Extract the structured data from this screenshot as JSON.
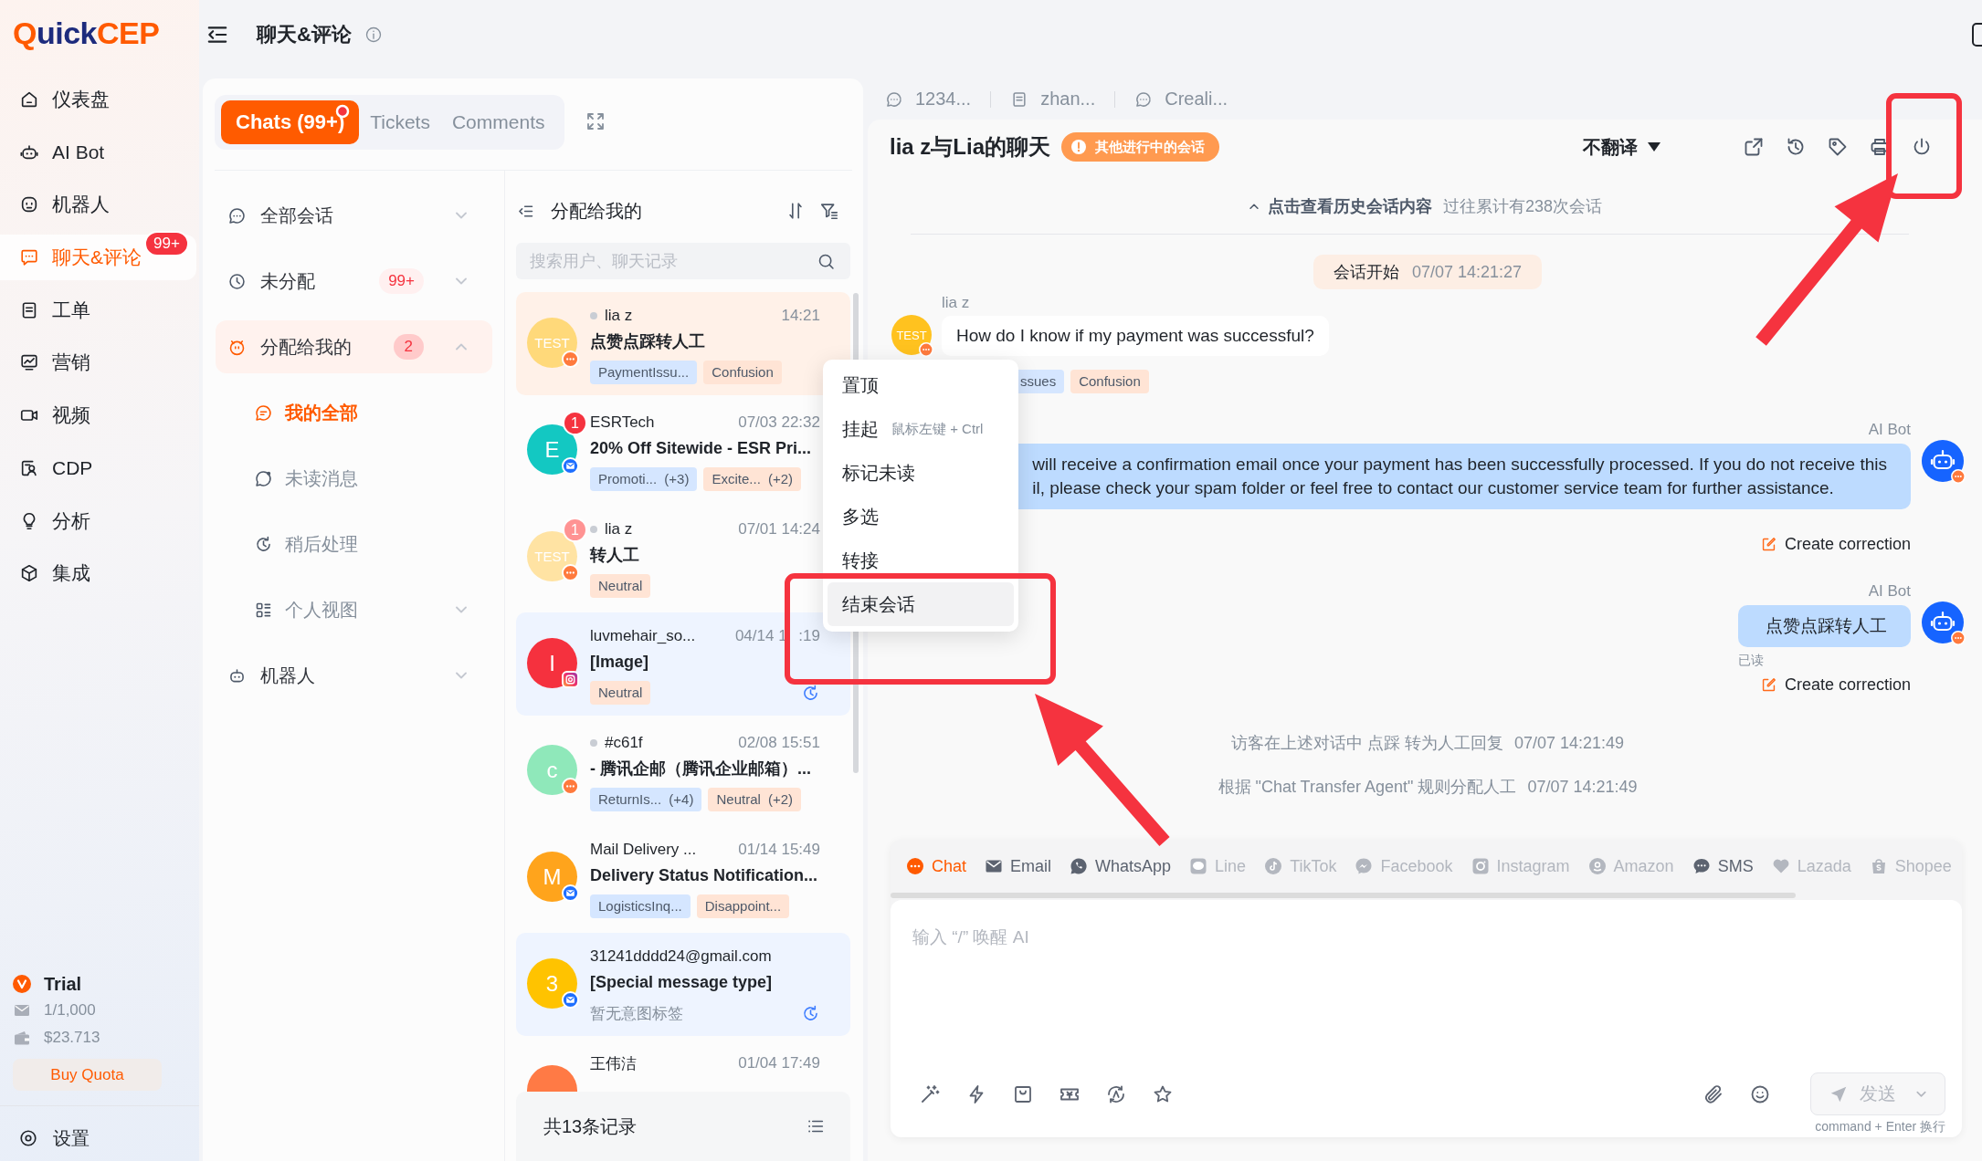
{
  "sidebar": {
    "logo": [
      "Q",
      "uick",
      "CEP"
    ],
    "nav": [
      {
        "label": "仪表盘",
        "kind": "dashboard",
        "selected": false
      },
      {
        "label": "AI Bot",
        "kind": "aibot",
        "selected": false
      },
      {
        "label": "机器人",
        "kind": "robot",
        "selected": false
      },
      {
        "label": "聊天&评论",
        "kind": "chat",
        "selected": true,
        "badge": "99+"
      },
      {
        "label": "工单",
        "kind": "ticket",
        "selected": false
      },
      {
        "label": "营销",
        "kind": "marketing",
        "selected": false
      },
      {
        "label": "视频",
        "kind": "video",
        "selected": false
      },
      {
        "label": "CDP",
        "kind": "cdp",
        "selected": false
      },
      {
        "label": "分析",
        "kind": "analytics",
        "selected": false
      },
      {
        "label": "集成",
        "kind": "integration",
        "selected": false
      }
    ],
    "plan": {
      "name": "Trial",
      "messages": "1/1,000",
      "balance": "$23.713",
      "button": "Buy Quota"
    },
    "settings": "设置"
  },
  "header": {
    "title": "聊天&评论"
  },
  "inbox": {
    "tabs": [
      {
        "label": "Chats (99+)",
        "selected": true,
        "dot": true
      },
      {
        "label": "Tickets",
        "selected": false,
        "dot": false
      },
      {
        "label": "Comments",
        "selected": false,
        "dot": false
      }
    ],
    "categories": [
      {
        "label": "全部会话",
        "kind": "all",
        "selected": false,
        "expanded": false
      },
      {
        "label": "未分配",
        "kind": "unassigned",
        "selected": false,
        "expanded": false,
        "badge": "99+"
      },
      {
        "label": "分配给我的",
        "kind": "mine",
        "selected": true,
        "expanded": true,
        "badge": "2",
        "children": [
          {
            "label": "我的全部",
            "kind": "my_all",
            "selected": true
          },
          {
            "label": "未读消息",
            "kind": "unread",
            "selected": false
          },
          {
            "label": "稍后处理",
            "kind": "later",
            "selected": false
          },
          {
            "label": "个人视图",
            "kind": "views",
            "selected": false,
            "expanded": false
          }
        ]
      },
      {
        "label": "机器人",
        "kind": "robot",
        "selected": false,
        "expanded": false
      }
    ],
    "list": {
      "title": "分配给我的",
      "search_placeholder": "搜索用户、聊天记录",
      "items": [
        {
          "name": "lia z",
          "status_dot": true,
          "time": "14:21",
          "preview": "点赞点踩转人工",
          "avatar": "TEST",
          "color": "#ffd97a",
          "channel": {
            "kind": "chat"
          },
          "selected": true,
          "later": false,
          "tags": [
            {
              "label": "PaymentIssu...",
              "kind": "intent"
            },
            {
              "label": "Confusion",
              "kind": "emotion"
            }
          ]
        },
        {
          "name": "ESRTech",
          "status_dot": false,
          "time": "07/03 22:32",
          "preview": "20% Off Sitewide - ESR Pri...",
          "avatar": "E",
          "color": "#13c8c2",
          "channel": {
            "kind": "email"
          },
          "unread": {
            "count": "1",
            "faded": false
          },
          "selected": false,
          "later": false,
          "tags": [
            {
              "label": "Promoti...",
              "more": "(+3)",
              "kind": "intent"
            },
            {
              "label": "Excite...",
              "more": "(+2)",
              "kind": "emotion"
            }
          ]
        },
        {
          "name": "lia z",
          "status_dot": true,
          "time": "07/01 14:24",
          "preview": "转人工",
          "avatar": "TEST",
          "color": "#ffe3a3",
          "channel": {
            "kind": "chat"
          },
          "unread": {
            "count": "1",
            "faded": true
          },
          "selected": false,
          "later": false,
          "tags": [
            {
              "label": "Neutral",
              "kind": "emotion"
            }
          ]
        },
        {
          "name": "luvmehair_so...",
          "status_dot": false,
          "time": "04/14 1",
          "time_tail": ":19",
          "preview": "[Image]",
          "avatar": "I",
          "color": "#f5313e",
          "channel": {
            "kind": "instagram"
          },
          "selected": false,
          "later": true,
          "tags": [
            {
              "label": "Neutral",
              "kind": "emotion"
            }
          ]
        },
        {
          "name": "#c61f",
          "status_dot": true,
          "time": "02/08 15:51",
          "preview": "- 腾讯企邮（腾讯企业邮箱）...",
          "avatar": "c",
          "color": "#8fe8ba",
          "channel": {
            "kind": "chat"
          },
          "selected": false,
          "later": false,
          "tags": [
            {
              "label": "ReturnIs...",
              "more": "(+4)",
              "kind": "intent"
            },
            {
              "label": "Neutral",
              "more": "(+2)",
              "kind": "emotion"
            }
          ]
        },
        {
          "name": "Mail Delivery ...",
          "status_dot": false,
          "time": "01/14 15:49",
          "preview": "Delivery Status Notification...",
          "avatar": "M",
          "color": "#ffa41c",
          "channel": {
            "kind": "email"
          },
          "selected": false,
          "later": false,
          "tags": [
            {
              "label": "LogisticsInq...",
              "kind": "intent"
            },
            {
              "label": "Disappoint...",
              "kind": "emotion"
            }
          ]
        },
        {
          "name": "31241dddd24@gmail.com",
          "status_dot": false,
          "preview": "[Special message type]",
          "avatar": "3",
          "color": "#ffc300",
          "channel": {
            "kind": "email"
          },
          "selected": false,
          "later": true,
          "no_tags": "暂无意图标签"
        },
        {
          "name": "王伟洁",
          "status_dot": false,
          "time": "01/04 17:49",
          "color": "#ff7a45",
          "selected": false,
          "later": false
        }
      ],
      "footer": "共13条记录"
    }
  },
  "context_menu": {
    "items": [
      {
        "label": "置顶",
        "selected": false
      },
      {
        "label": "挂起",
        "shortcut": "鼠标左键 + Ctrl",
        "selected": false
      },
      {
        "label": "标记未读",
        "selected": false
      },
      {
        "label": "多选",
        "selected": false
      },
      {
        "label": "转接",
        "selected": false
      },
      {
        "label": "结束会话",
        "selected": true
      }
    ]
  },
  "conversation_tabs": [
    {
      "label": "1234...",
      "kind": "chat"
    },
    {
      "label": "zhan...",
      "kind": "ticket"
    },
    {
      "label": "Creali...",
      "kind": "chat"
    }
  ],
  "chat": {
    "title": "lia z与Lia的聊天",
    "notice": "其他进行中的会话",
    "translate": "不翻译",
    "history": {
      "link": "点击查看历史会话内容",
      "count": "过往累计有238次会话"
    },
    "session_start": {
      "label": "会话开始",
      "time": "07/07 14:21:27"
    },
    "messages": [
      {
        "kind": "visitor",
        "sender": "lia z",
        "avatar": "TEST",
        "lines": [
          "How do I know if my payment was successful?"
        ],
        "tags": [
          {
            "label": "ssues",
            "kind": "intent"
          },
          {
            "label": "Confusion",
            "kind": "emotion"
          }
        ]
      },
      {
        "kind": "bot",
        "sender": "AI Bot",
        "lines": [
          "will receive a confirmation email once your payment has been successfully processed. If you do not receive this",
          "il, please check your spam folder or feel free to contact our customer service team for further assistance."
        ],
        "action": "Create correction"
      },
      {
        "kind": "bot",
        "sender": "AI Bot",
        "lines": [
          "点赞点踩转人工"
        ],
        "status": "已读",
        "action": "Create correction"
      },
      {
        "kind": "system",
        "text": "访客在上述对话中 点踩 转为人工回复",
        "time": "07/07 14:21:49"
      },
      {
        "kind": "system",
        "text": "根据 \"Chat Transfer Agent\" 规则分配人工",
        "time": "07/07 14:21:49"
      }
    ]
  },
  "composer": {
    "channels": [
      {
        "label": "Chat",
        "kind": "chat",
        "selected": true,
        "disabled": false
      },
      {
        "label": "Email",
        "kind": "email",
        "selected": false,
        "disabled": false
      },
      {
        "label": "WhatsApp",
        "kind": "whatsapp",
        "selected": false,
        "disabled": false
      },
      {
        "label": "Line",
        "kind": "line",
        "selected": false,
        "disabled": true
      },
      {
        "label": "TikTok",
        "kind": "tiktok",
        "selected": false,
        "disabled": true
      },
      {
        "label": "Facebook",
        "kind": "facebook",
        "selected": false,
        "disabled": true
      },
      {
        "label": "Instagram",
        "kind": "instagram",
        "selected": false,
        "disabled": true
      },
      {
        "label": "Amazon",
        "kind": "amazon",
        "selected": false,
        "disabled": true
      },
      {
        "label": "SMS",
        "kind": "sms",
        "selected": false,
        "disabled": false
      },
      {
        "label": "Lazada",
        "kind": "lazada",
        "selected": false,
        "disabled": true
      },
      {
        "label": "Shopee",
        "kind": "shopee",
        "selected": false,
        "disabled": true
      }
    ],
    "placeholder": "输入 “/” 唤醒 AI",
    "send": {
      "label": "发送",
      "disabled": true
    },
    "hint": "command + Enter 换行"
  },
  "annotations": [
    {
      "kind": "frame"
    },
    {
      "kind": "arrow"
    },
    {
      "kind": "frame"
    },
    {
      "kind": "arrow"
    }
  ]
}
